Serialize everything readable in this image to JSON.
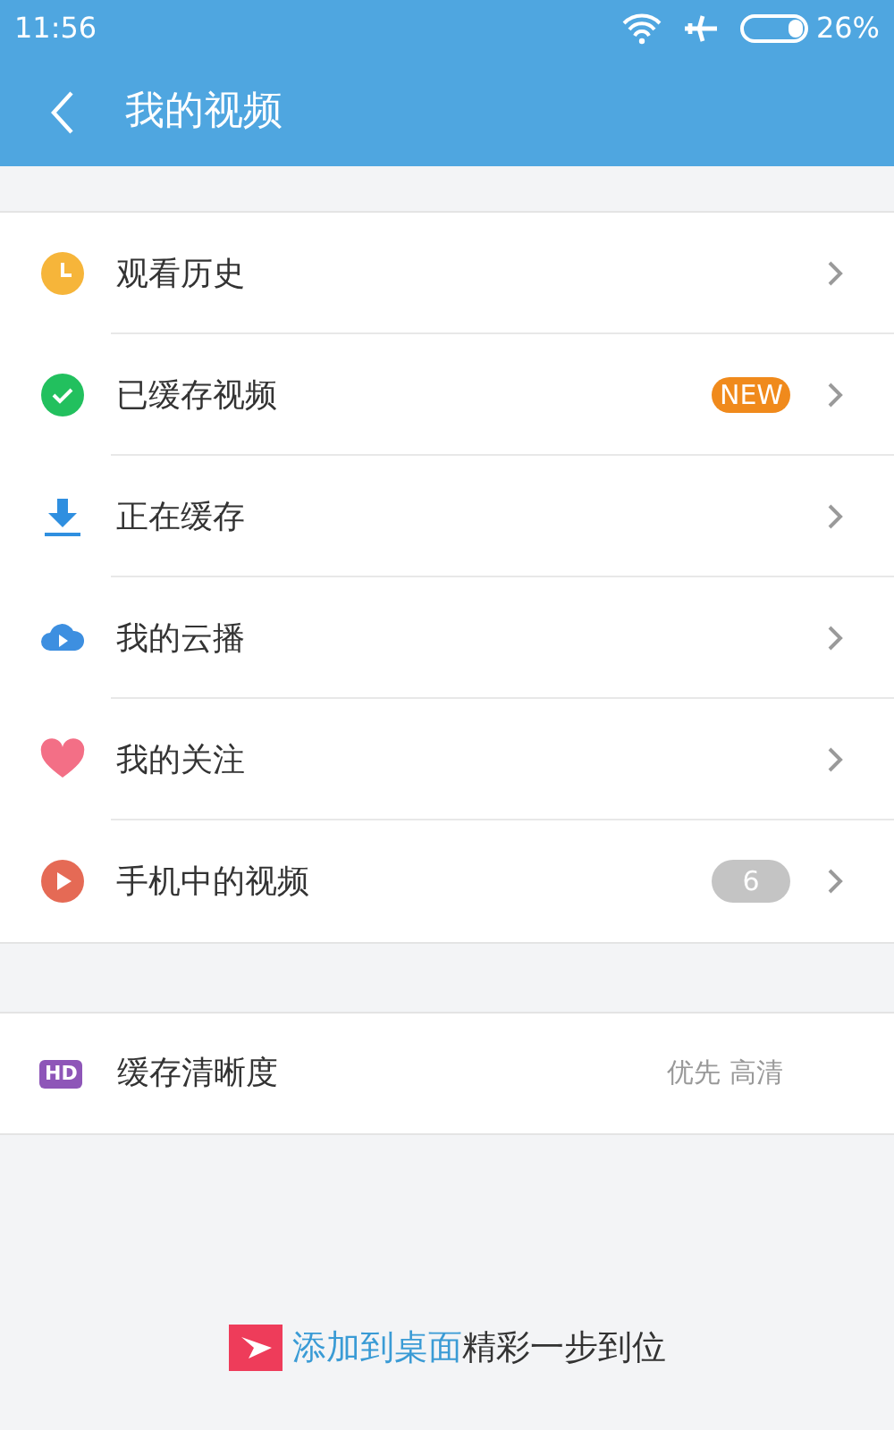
{
  "status_bar": {
    "time": "11:56",
    "battery": "26%"
  },
  "header": {
    "title": "我的视频"
  },
  "menu": [
    {
      "label": "观看历史",
      "kind": "clock"
    },
    {
      "label": "已缓存视频",
      "kind": "check",
      "badge": {
        "kind": "new",
        "text": "NEW"
      }
    },
    {
      "label": "正在缓存",
      "kind": "download"
    },
    {
      "label": "我的云播",
      "kind": "cloud"
    },
    {
      "label": "我的关注",
      "kind": "heart"
    },
    {
      "label": "手机中的视频",
      "kind": "play",
      "badge": {
        "kind": "count",
        "text": "6"
      }
    }
  ],
  "settings": [
    {
      "icon_text": "HD",
      "label": "缓存清晰度",
      "value": "优先 高清"
    }
  ],
  "footer": {
    "link": "添加到桌面",
    "text": "精彩一步到位"
  }
}
